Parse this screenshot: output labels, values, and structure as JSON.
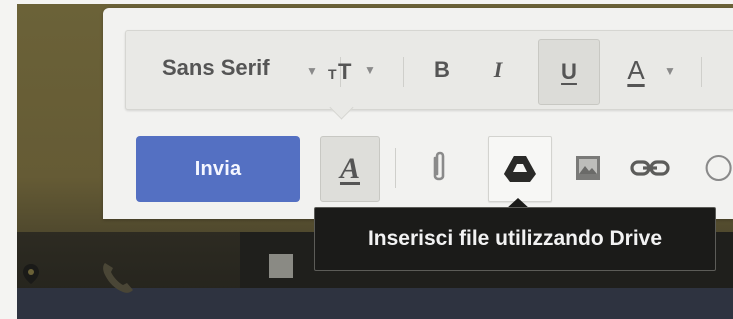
{
  "format_bar": {
    "font_family": "Sans Serif",
    "font_size_icon": "text-size-icon",
    "bold_label": "B",
    "italic_label": "I",
    "underline_label": "U",
    "text_color_label": "A"
  },
  "toolbar": {
    "send_label": "Invia",
    "formatting_toggle_label": "A",
    "attach_icon": "paperclip-icon",
    "drive_icon": "google-drive-icon",
    "photo_icon": "insert-photo-icon",
    "link_icon": "link-icon",
    "emoji_icon": "emoji-icon"
  },
  "tooltip": {
    "text": "Inserisci file utilizzando Drive"
  },
  "colors": {
    "send_button": "#5470c2",
    "tooltip_bg": "#1b1b19",
    "panel_bg": "#f2f2f0"
  }
}
